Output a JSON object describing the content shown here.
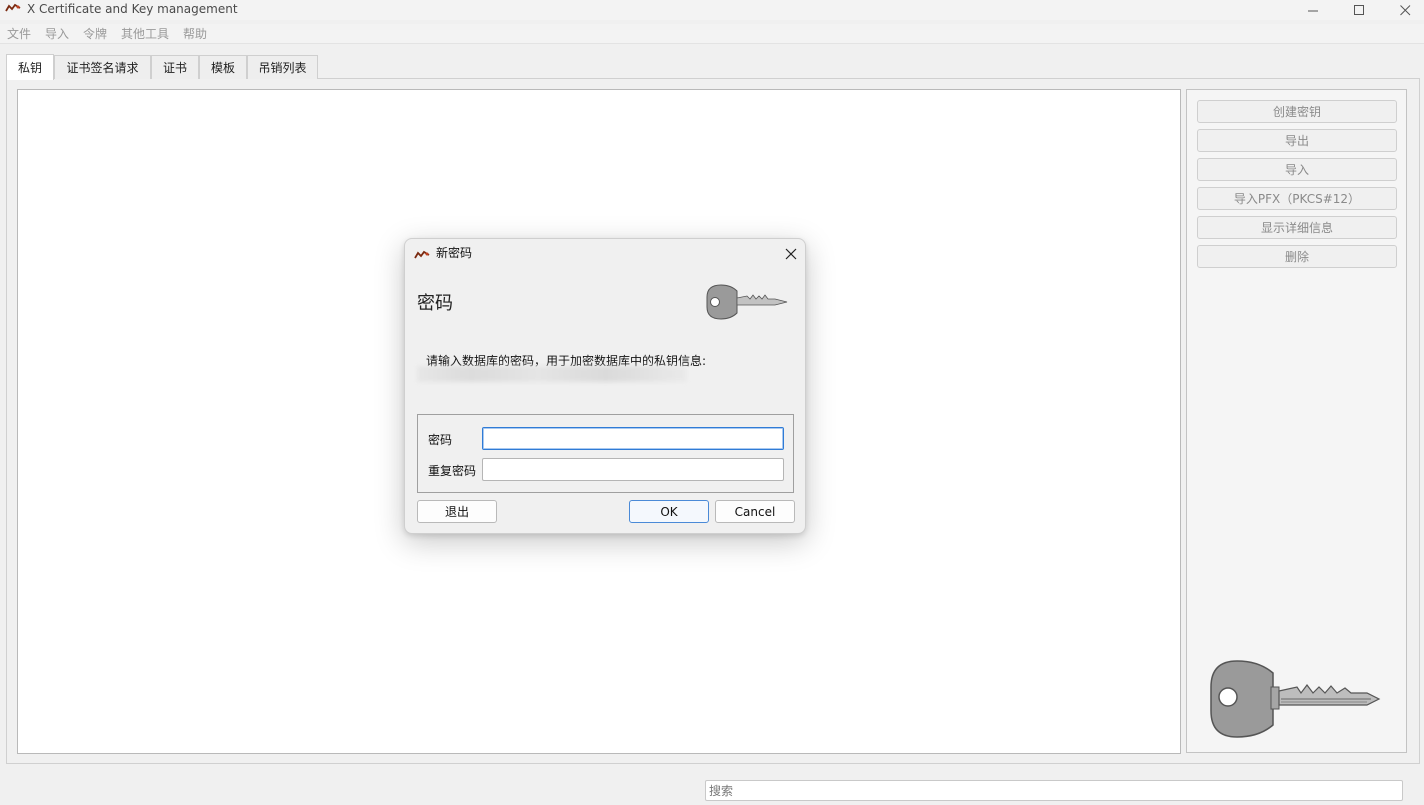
{
  "window": {
    "title": "X Certificate and Key management",
    "icons": [
      "app-icon",
      "minimize-icon",
      "maximize-icon",
      "close-icon"
    ]
  },
  "menu": {
    "items": [
      "文件",
      "导入",
      "令牌",
      "其他工具",
      "帮助"
    ]
  },
  "tabs": [
    {
      "label": "私钥",
      "active": true
    },
    {
      "label": "证书签名请求",
      "active": false
    },
    {
      "label": "证书",
      "active": false
    },
    {
      "label": "模板",
      "active": false
    },
    {
      "label": "吊销列表",
      "active": false
    }
  ],
  "side_buttons": [
    "创建密钥",
    "导出",
    "导入",
    "导入PFX（PKCS#12）",
    "显示详细信息",
    "删除"
  ],
  "search": {
    "placeholder": "搜索",
    "value": ""
  },
  "dialog": {
    "title": "新密码",
    "heading": "密码",
    "description": "请输入数据库的密码，用于加密数据库中的私钥信息:",
    "password_label": "密码",
    "repeat_label": "重复密码",
    "password_value": "",
    "repeat_value": "",
    "exit_label": "退出",
    "ok_label": "OK",
    "cancel_label": "Cancel"
  },
  "colors": {
    "focus_border": "#2f7bd6",
    "disabled_text": "#8a8a8a",
    "menu_text": "#9a9a9a"
  }
}
